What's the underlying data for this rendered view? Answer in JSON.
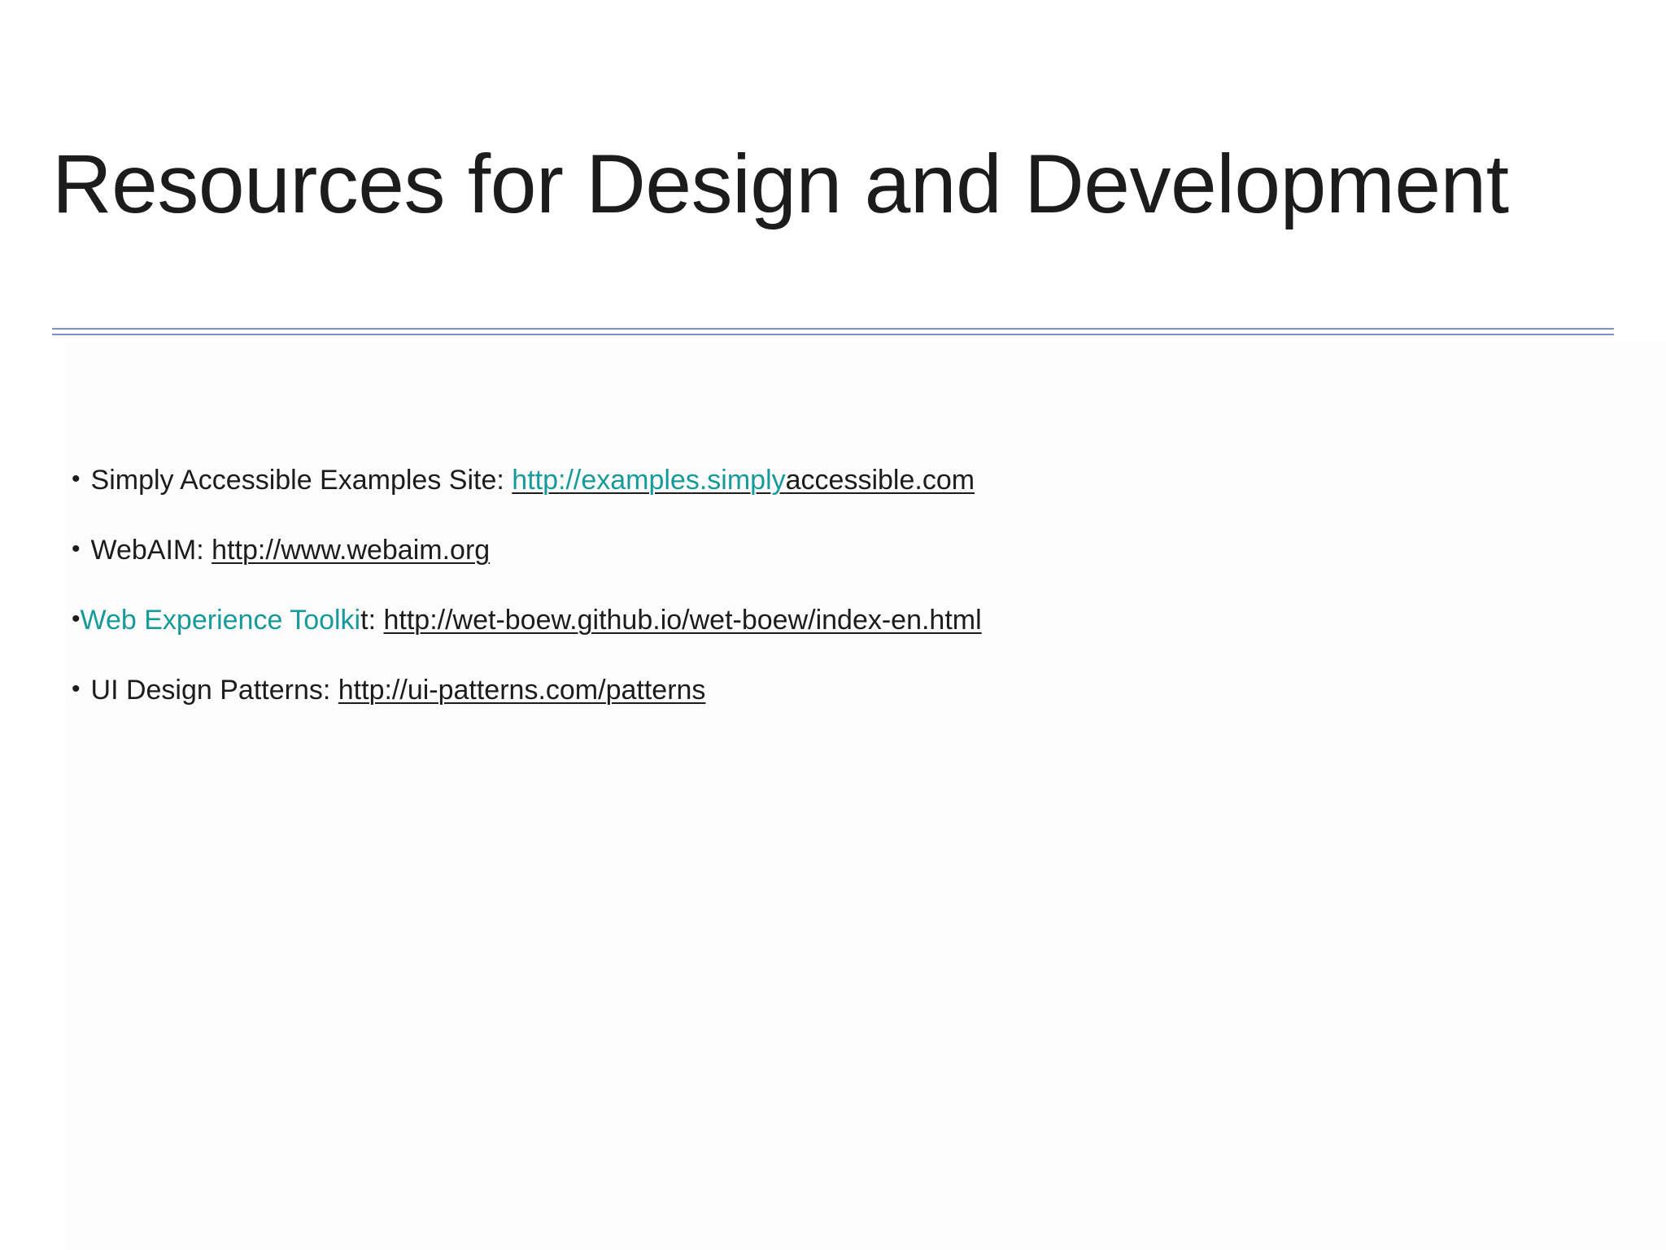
{
  "slide": {
    "title": "Resources for Design and Development"
  },
  "bullet_symbol": "•",
  "items": [
    {
      "label": "Simply Accessible Examples Site:",
      "url_part1": "http://examples.simply",
      "url_part2": "accessible.com"
    },
    {
      "label": "WebAIM:",
      "url": "http://www.webaim.org"
    },
    {
      "label_highlight": "Web Experience Toolki",
      "label_rest": "t:",
      "url": "http://wet-boew.github.io/wet-boew/index-en.html"
    },
    {
      "label": "UI Design Patterns:",
      "url": "http://ui-patterns.com/patterns"
    }
  ],
  "colors": {
    "text": "#1c1c1c",
    "accent": "#169a9a",
    "rule": "#7f8fc4"
  }
}
